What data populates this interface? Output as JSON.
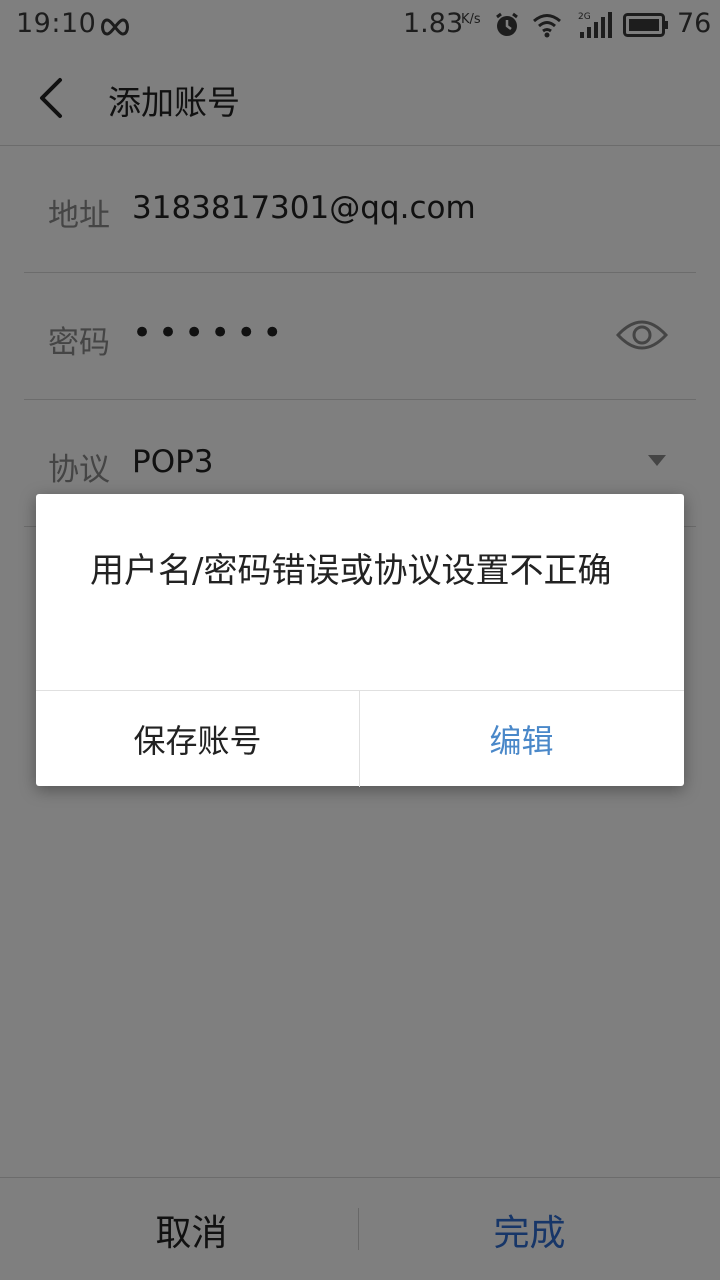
{
  "status_bar": {
    "time": "19:10",
    "net_speed": "1.83",
    "net_speed_unit": "K/s",
    "network_type": "2G",
    "battery_level": "76",
    "icons": [
      "infinity-icon",
      "alarm-icon",
      "wifi-icon",
      "signal-icon",
      "battery-icon"
    ]
  },
  "app_bar": {
    "title": "添加账号"
  },
  "form": {
    "address": {
      "label": "地址",
      "value": "3183817301@qq.com"
    },
    "password": {
      "label": "密码",
      "value": "••••••"
    },
    "protocol": {
      "label": "协议",
      "value": "POP3"
    }
  },
  "bottom_bar": {
    "cancel_label": "取消",
    "done_label": "完成"
  },
  "dialog": {
    "message": "用户名/密码错误或协议设置不正确",
    "save_account_label": "保存账号",
    "edit_label": "编辑"
  },
  "colors": {
    "accent": "#2f6cd1",
    "dialog_accent": "#4a88c9",
    "scrim": "rgba(0,0,0,0.5)"
  }
}
